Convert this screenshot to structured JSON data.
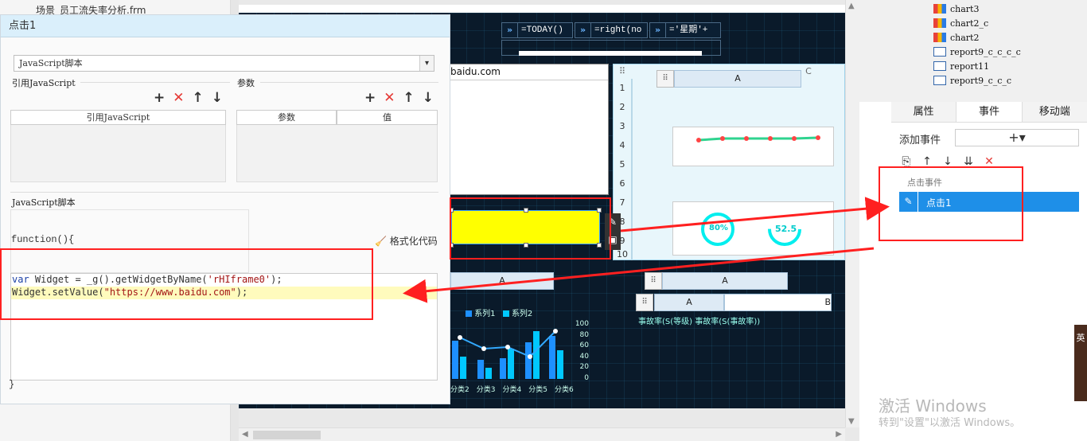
{
  "left_tree": {
    "partial_item": "场景_员工流失率分析.frm"
  },
  "dialog": {
    "title": "点击1",
    "type_select": "JavaScript脚本",
    "ref_js_label": "引用JavaScript",
    "params_label": "参数",
    "ref_js_col": "引用JavaScript",
    "param_col": "参数",
    "value_col": "值",
    "js_section_label": "JavaScript脚本",
    "fn_open": "function(){",
    "format_label": "格式化代码",
    "code_line1_kw": "var",
    "code_line1_mid": " Widget = _g().getWidgetByName(",
    "code_line1_str": "'rHIframe0'",
    "code_line1_end": ");",
    "code_line2_start": "Widget.setValue(",
    "code_line2_str": "\"https://www.baidu.com\"",
    "code_line2_end": ");",
    "fn_close": "}"
  },
  "canvas": {
    "formula1": "=TODAY()",
    "formula2": "=right(no",
    "formula3": "='星期'+",
    "url_text": "baidu.com",
    "col_a": "A",
    "col_c": "C",
    "row_numbers": [
      "1",
      "2",
      "3",
      "4",
      "5",
      "6",
      "7",
      "8",
      "9",
      "10"
    ],
    "legend1": "系列1",
    "legend2": "系列2",
    "axis_ticks": [
      "100",
      "80",
      "60",
      "40",
      "20",
      "0"
    ],
    "x_labels": [
      "分类2",
      "分类3",
      "分类4",
      "分类5",
      "分类6"
    ],
    "gauge1": "80%",
    "gauge2": "52.5",
    "accident_text": "事故率(S(等级) 事故率(S(事故率))",
    "col_b": "B"
  },
  "right_panel": {
    "tree_items": [
      {
        "label": "chart3",
        "kind": "chart"
      },
      {
        "label": "chart2_c",
        "kind": "chart"
      },
      {
        "label": "chart2",
        "kind": "chart"
      },
      {
        "label": "report9_c_c_c_c",
        "kind": "report"
      },
      {
        "label": "report11",
        "kind": "report"
      },
      {
        "label": "report9_c_c_c",
        "kind": "report"
      }
    ],
    "tabs": [
      "属性",
      "事件",
      "移动端"
    ],
    "add_event_label": "添加事件",
    "add_button": "+▾",
    "event_category": "点击事件",
    "event_item": "点击1"
  },
  "watermark": {
    "line1": "激活 Windows",
    "line2": "转到\"设置\"以激活 Windows。"
  },
  "side_tab_chars": "英"
}
